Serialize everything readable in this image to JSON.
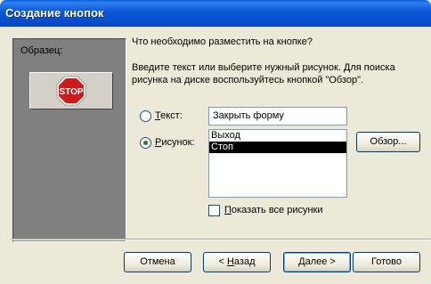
{
  "window": {
    "title": "Создание кнопок"
  },
  "sample": {
    "label": "Образец:",
    "button_text": "STOP"
  },
  "prompt": {
    "question": "Что необходимо разместить на кнопке?",
    "instruction_line1": "Введите текст или выберите нужный рисунок.  Для поиска",
    "instruction_line2": "рисунка на диске воспользуйтесь кнопкой \"Обзор\"."
  },
  "options": {
    "text_label_accel": "Т",
    "text_label_rest": "екст:",
    "text_selected": false,
    "text_value": "Закрыть форму",
    "picture_label_accel": "Р",
    "picture_label_rest": "исунок:",
    "picture_selected": true,
    "pictures": [
      {
        "label": "Выход",
        "selected": false
      },
      {
        "label": "Стоп",
        "selected": true
      }
    ],
    "browse_label": "Обзор...",
    "show_all_accel": "П",
    "show_all_rest": "оказать все рисунки",
    "show_all_checked": false
  },
  "buttons": {
    "cancel": "Отмена",
    "back_prefix": "< ",
    "back_accel": "Н",
    "back_rest": "азад",
    "next_accel": "Д",
    "next_rest": "алее >",
    "finish": "Готово"
  },
  "colors": {
    "title_bar": "#0a5fd8",
    "dialog_bg": "#ece9d8",
    "sample_bg": "#808080",
    "stop_red": "#cc1c1c"
  }
}
